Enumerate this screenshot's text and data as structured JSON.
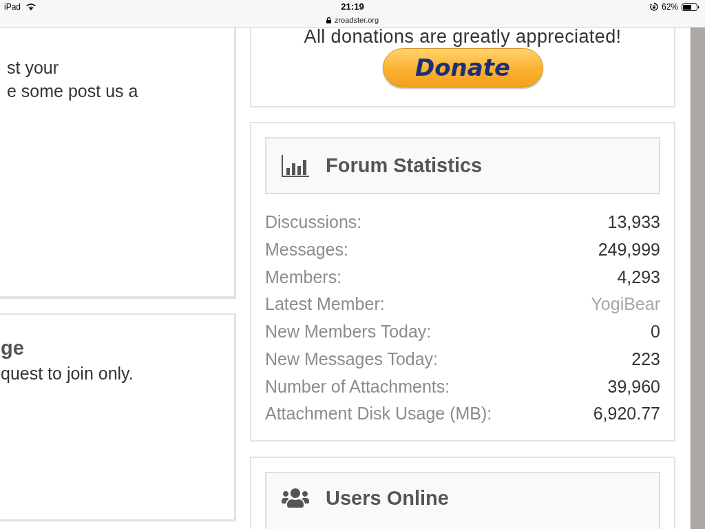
{
  "status_bar": {
    "device": "iPad",
    "time": "21:19",
    "url": "zroadster.org",
    "battery_percent": "62%"
  },
  "left_cards": [
    {
      "lines": [
        "st your",
        "e some post us a"
      ]
    },
    {
      "title": "ge",
      "lines": [
        "quest to join only."
      ]
    }
  ],
  "donate_card": {
    "message": "All donations are greatly appreciated!",
    "button": "Donate"
  },
  "forum_statistics": {
    "title": "Forum Statistics",
    "rows": [
      {
        "label": "Discussions:",
        "value": "13,933",
        "kind": "number"
      },
      {
        "label": "Messages:",
        "value": "249,999",
        "kind": "number"
      },
      {
        "label": "Members:",
        "value": "4,293",
        "kind": "number"
      },
      {
        "label": "Latest Member:",
        "value": "YogiBear",
        "kind": "link"
      },
      {
        "label": "New Members Today:",
        "value": "0",
        "kind": "number"
      },
      {
        "label": "New Messages Today:",
        "value": "223",
        "kind": "number"
      },
      {
        "label": "Number of Attachments:",
        "value": "39,960",
        "kind": "number"
      },
      {
        "label": "Attachment Disk Usage (MB):",
        "value": "6,920.77",
        "kind": "number"
      }
    ]
  },
  "users_online": {
    "title": "Users Online"
  }
}
